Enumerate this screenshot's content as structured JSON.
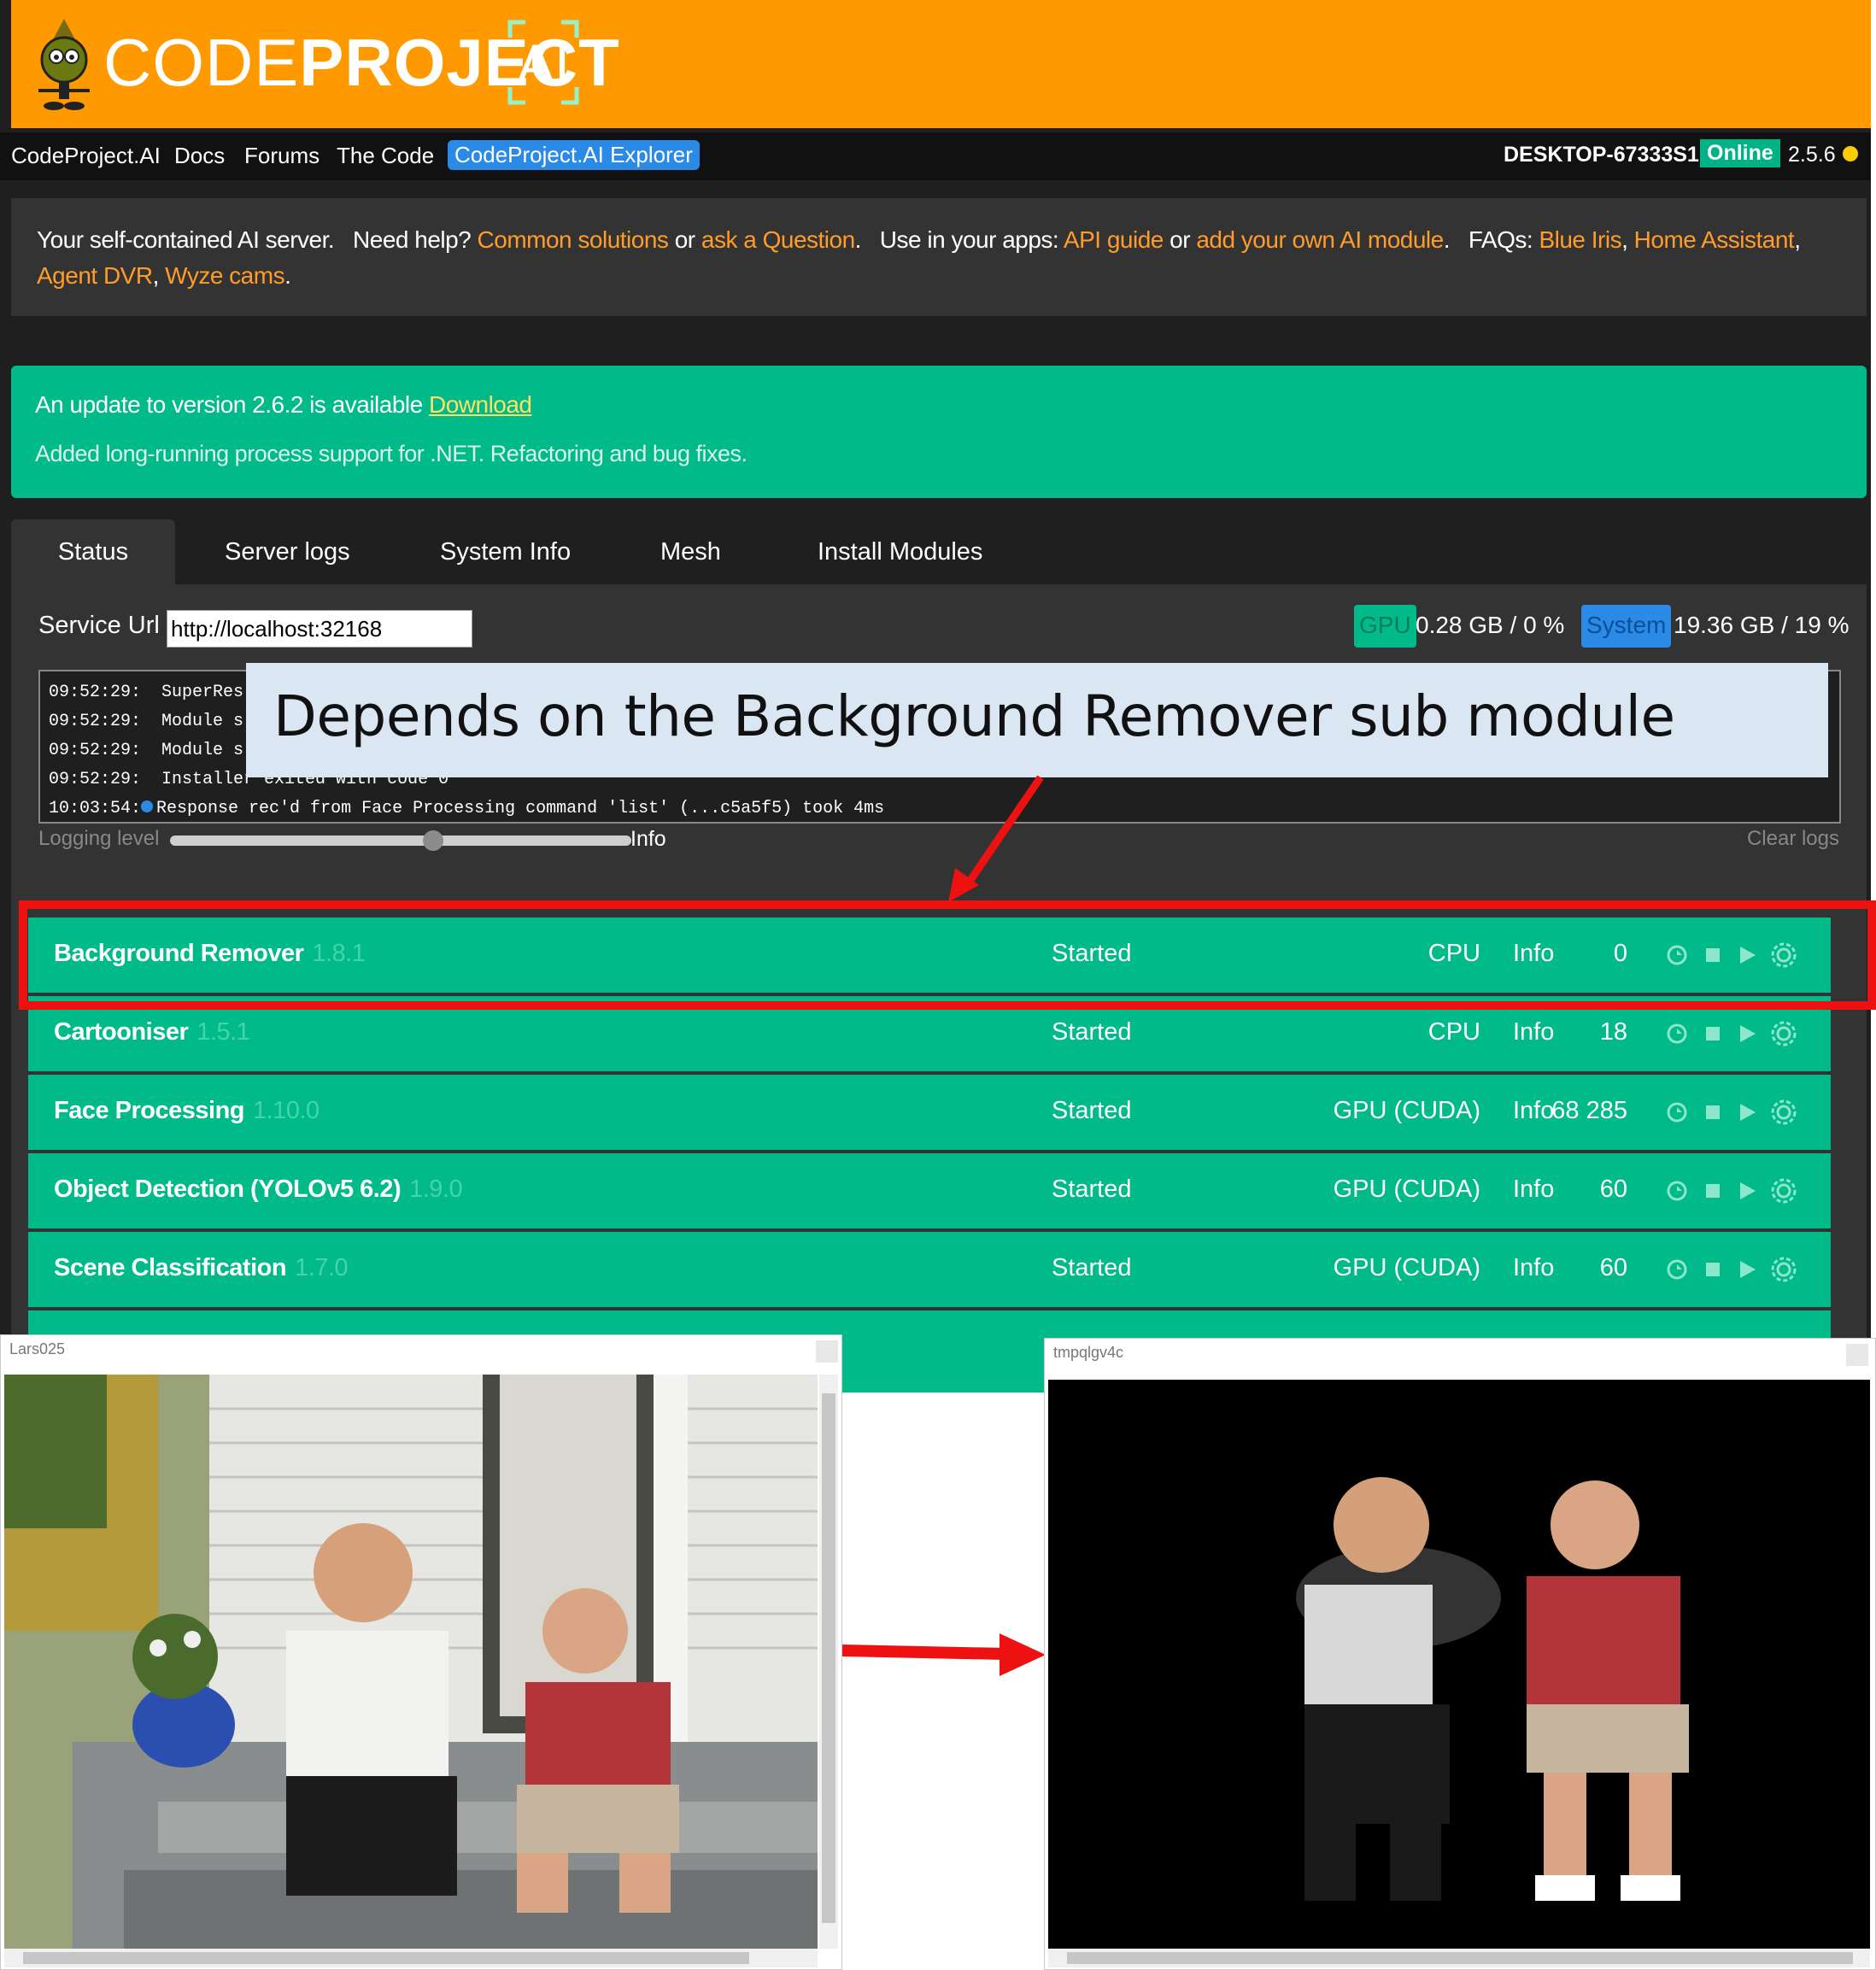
{
  "brand": {
    "word_light": "CODE",
    "word_bold": "PROJECT",
    "ai": "AI"
  },
  "nav": {
    "links": [
      "CodeProject.AI",
      "Docs",
      "Forums",
      "The Code",
      "CodeProject.AI Explorer"
    ],
    "host": "DESKTOP-67333S1",
    "status": "Online",
    "version": "2.5.6"
  },
  "help": {
    "t1": "Your self-contained AI server.",
    "t2": "Need help?",
    "l1": "Common solutions",
    "t3": "or",
    "l2": "ask a Question",
    "t4": ".",
    "t5": "Use in your apps:",
    "l3": "API guide",
    "t6": "or",
    "l4": "add your own AI module",
    "t7": ".",
    "t8": "FAQs:",
    "l5": "Blue Iris",
    "c1": ",",
    "l6": "Home Assistant",
    "c2": ",",
    "l7": "Agent DVR",
    "c3": ",",
    "l8": "Wyze cams",
    "t9": "."
  },
  "update": {
    "text": "An update to version 2.6.2 is available",
    "link": "Download",
    "notes": "Added long-running process support for .NET. Refactoring and bug fixes."
  },
  "tabs": [
    "Status",
    "Server logs",
    "System Info",
    "Mesh",
    "Install Modules"
  ],
  "service": {
    "label": "Service Url",
    "url": "http://localhost:32168",
    "gpu_label": "GPU",
    "gpu_value": "0.28 GB / 0 %",
    "system_label": "System",
    "system_value": "19.36 GB / 19 %"
  },
  "logs": {
    "lines": [
      "09:52:29:  SuperRes",
      "09:52:29:  Module s",
      "09:52:29:  Module s",
      "09:52:29:  Installer exited with code 0"
    ],
    "last_time": "10:03:54:",
    "last_msg": "Response rec'd from Face Processing command 'list' (...c5a5f5) took 4ms",
    "level_label": "Logging level",
    "level_value": "Info",
    "clear": "Clear logs",
    "level_fraction": 0.57
  },
  "modules": [
    {
      "name": "Background Remover",
      "version": "1.8.1",
      "status": "Started",
      "processor": "CPU",
      "info": "Info",
      "count": "0"
    },
    {
      "name": "Cartooniser",
      "version": "1.5.1",
      "status": "Started",
      "processor": "CPU",
      "info": "Info",
      "count": "18"
    },
    {
      "name": "Face Processing",
      "version": "1.10.0",
      "status": "Started",
      "processor": "GPU (CUDA)",
      "info": "Info",
      "count": "68 285"
    },
    {
      "name": "Object Detection (YOLOv5 6.2)",
      "version": "1.9.0",
      "status": "Started",
      "processor": "GPU (CUDA)",
      "info": "Info",
      "count": "60"
    },
    {
      "name": "Scene Classification",
      "version": "1.7.0",
      "status": "Started",
      "processor": "GPU (CUDA)",
      "info": "Info",
      "count": "60"
    }
  ],
  "annotation": {
    "callout": "Depends on the Background Remover sub module"
  },
  "windows": {
    "left_title": "Lars025",
    "right_title": "tmpqlgv4c"
  },
  "colors": {
    "brand": "#ff9900",
    "accent_green": "#00ba8a",
    "accent_blue": "#2b8ae6",
    "link_orange": "#ff9c2a",
    "annotation_red": "#ee1111"
  }
}
